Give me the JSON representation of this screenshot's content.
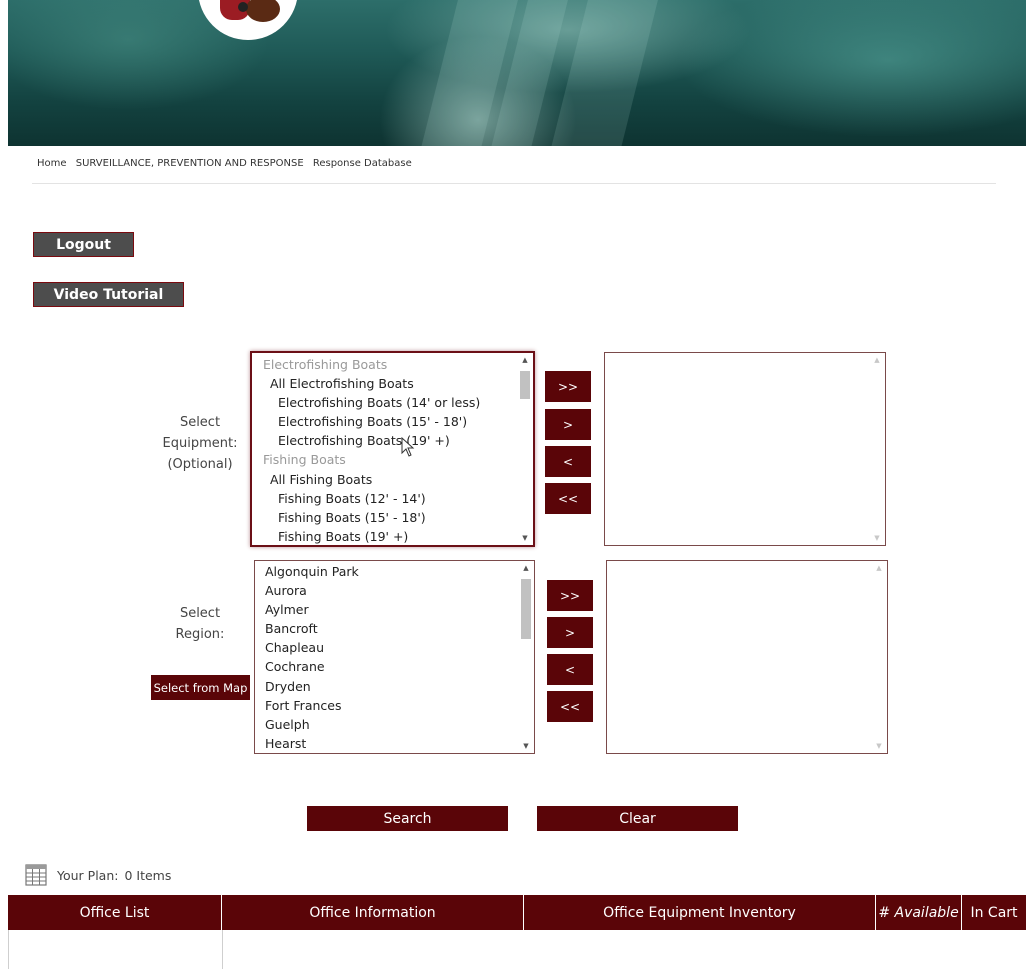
{
  "breadcrumb": [
    "Home",
    "SURVEILLANCE, PREVENTION AND RESPONSE",
    "Response Database"
  ],
  "buttons": {
    "logout": "Logout",
    "video_tutorial": "Video Tutorial",
    "select_from_map": "Select from Map",
    "search": "Search",
    "clear": "Clear",
    "add_all": ">>",
    "add_one": ">",
    "remove_one": "<",
    "remove_all": "<<"
  },
  "equipment": {
    "label_line1": "Select",
    "label_line2": "Equipment:",
    "label_line3": "(Optional)",
    "options": [
      {
        "text": "Electrofishing Boats",
        "level": "group"
      },
      {
        "text": "All Electrofishing Boats",
        "level": "l1"
      },
      {
        "text": "Electrofishing Boats (14' or less)",
        "level": "l2"
      },
      {
        "text": "Electrofishing Boats (15' - 18')",
        "level": "l2"
      },
      {
        "text": "Electrofishing Boats (19' +)",
        "level": "l2"
      },
      {
        "text": "Fishing Boats",
        "level": "group"
      },
      {
        "text": "All Fishing Boats",
        "level": "l1"
      },
      {
        "text": "Fishing Boats (12' - 14')",
        "level": "l2"
      },
      {
        "text": "Fishing Boats (15' - 18')",
        "level": "l2"
      },
      {
        "text": "Fishing Boats (19' +)",
        "level": "l2"
      }
    ]
  },
  "region": {
    "label_line1": "Select",
    "label_line2": "Region:",
    "options": [
      "Algonquin Park",
      "Aurora",
      "Aylmer",
      "Bancroft",
      "Chapleau",
      "Cochrane",
      "Dryden",
      "Fort Frances",
      "Guelph",
      "Hearst"
    ]
  },
  "plan": {
    "label": "Your Plan:",
    "count": "0 Items"
  },
  "table": {
    "columns": [
      "Office List",
      "Office Information",
      "Office Equipment Inventory",
      "# Available",
      "In Cart"
    ]
  },
  "colors": {
    "maroon": "#5a0508",
    "dark_button": "#4d4d4d"
  }
}
